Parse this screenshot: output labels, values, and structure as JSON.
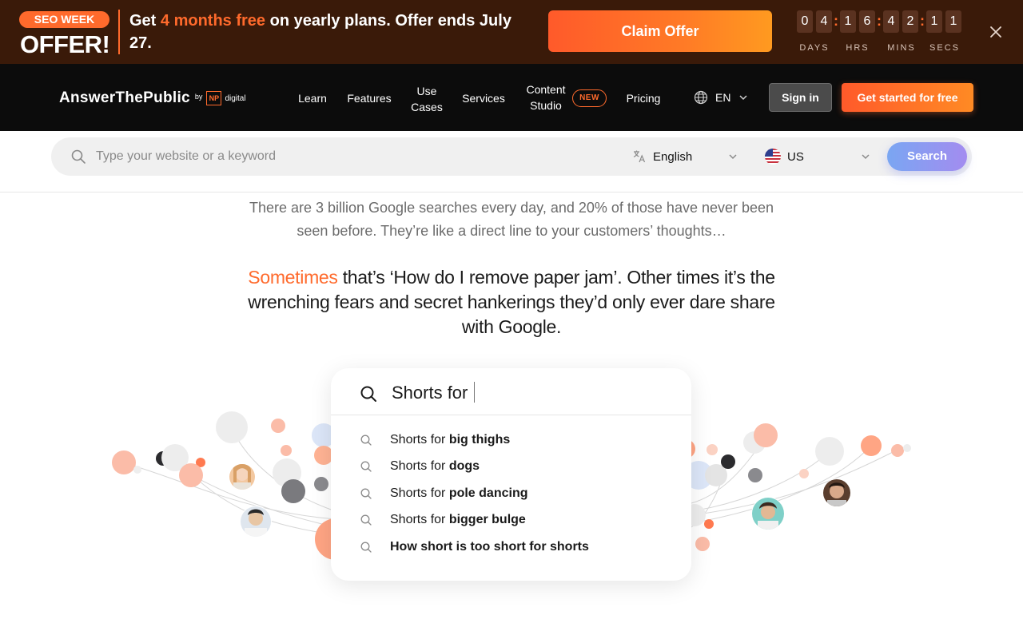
{
  "promo": {
    "badge": "SEO WEEK",
    "offer": "OFFER!",
    "text_prefix": "Get ",
    "text_highlight": "4 months free",
    "text_suffix": " on yearly plans. Offer ends July 27.",
    "claim_label": "Claim Offer",
    "countdown": {
      "days": [
        "0",
        "4"
      ],
      "hrs": [
        "1",
        "6"
      ],
      "mins": [
        "4",
        "2"
      ],
      "secs": [
        "1",
        "1"
      ],
      "separator": ":",
      "labels": [
        "DAYS",
        "HRS",
        "MINS",
        "SECS"
      ]
    },
    "colors": {
      "background": "#3a1a09",
      "accent": "#ff6a2c"
    }
  },
  "nav": {
    "logo": {
      "name": "AnswerThePublic",
      "by": "by",
      "np": "NP",
      "digital": "digital"
    },
    "items": [
      "Learn",
      "Features",
      "Use Cases",
      "Services",
      "Content Studio",
      "Pricing"
    ],
    "new_badge": "NEW",
    "language": "EN",
    "signin": "Sign in",
    "get_started": "Get started for free"
  },
  "search": {
    "placeholder": "Type your website or a keyword",
    "language": "English",
    "country": "US",
    "button": "Search"
  },
  "intro": {
    "text": "There are 3 billion Google searches every day, and 20% of those have never been seen before. They’re like a direct line to your customers’ thoughts…",
    "headline_highlight": "Sometimes",
    "headline_rest": " that’s ‘How do I remove paper jam’. Other times it’s the wrenching fears and secret hankerings they’d only ever dare share with Google."
  },
  "suggest": {
    "query": "Shorts for",
    "items": [
      {
        "prefix": "Shorts for ",
        "bold": "big thighs"
      },
      {
        "prefix": "Shorts for ",
        "bold": "dogs"
      },
      {
        "prefix": "Shorts for ",
        "bold": "pole dancing"
      },
      {
        "prefix": "Shorts for ",
        "bold": "bigger bulge"
      },
      {
        "prefix": "",
        "bold": "How short is too short for shorts"
      }
    ]
  }
}
